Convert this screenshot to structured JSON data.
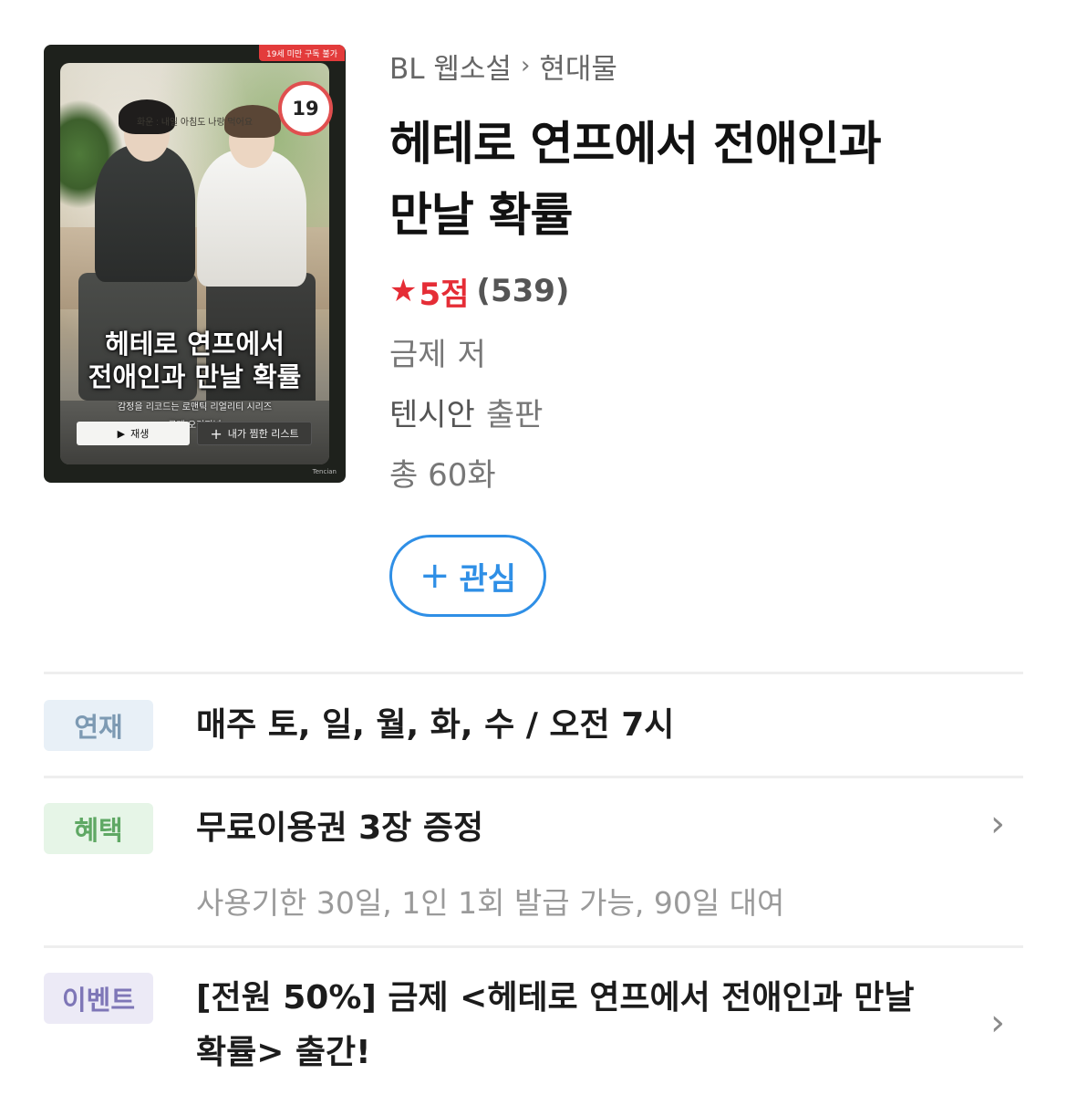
{
  "cover": {
    "age_banner": "19세 미만 구독 불가",
    "age_badge": "19",
    "tagline": "화운 : 내일 아침도 나랑 먹어요",
    "title_line1": "헤테로 연프에서",
    "title_line2": "전애인과 만날 확률",
    "subtitle": "감정을 리코드는 로맨틱 리얼리티 시리즈",
    "author_line": "금제 오리지널",
    "play_label": "재생",
    "list_label": "내가 찜한 리스트",
    "publisher_mark": "Tencian"
  },
  "breadcrumb": {
    "category": "BL 웹소설",
    "separator": "›",
    "subcategory": "현대물"
  },
  "book": {
    "title_line1": "헤테로 연프에서 전애인과",
    "title_line2": "만날 확률",
    "rating_star": "★",
    "rating_score": "5점",
    "rating_count": "(539)",
    "author": "금제",
    "author_suffix": "저",
    "publisher": "텐시안",
    "publisher_suffix": "출판",
    "episodes": "총 60화"
  },
  "interest_button": {
    "icon": "plus-icon",
    "label": "관심"
  },
  "rows": {
    "serial": {
      "tag": "연재",
      "text": "매주 토, 일, 월, 화, 수 / 오전 7시"
    },
    "benefit": {
      "tag": "혜택",
      "text": "무료이용권 3장 증정",
      "sub": "사용기한 30일, 1인 1회 발급 가능, 90일 대여"
    },
    "event": {
      "tag": "이벤트",
      "text_line1": "[전원 50%] 금제 <헤테로 연프에서 전애인과 만날",
      "text_line2": "확률> 출간!"
    }
  },
  "colors": {
    "accent_blue": "#2f8fe6",
    "rating_red": "#e52d36",
    "age_red": "#e04f4f"
  }
}
